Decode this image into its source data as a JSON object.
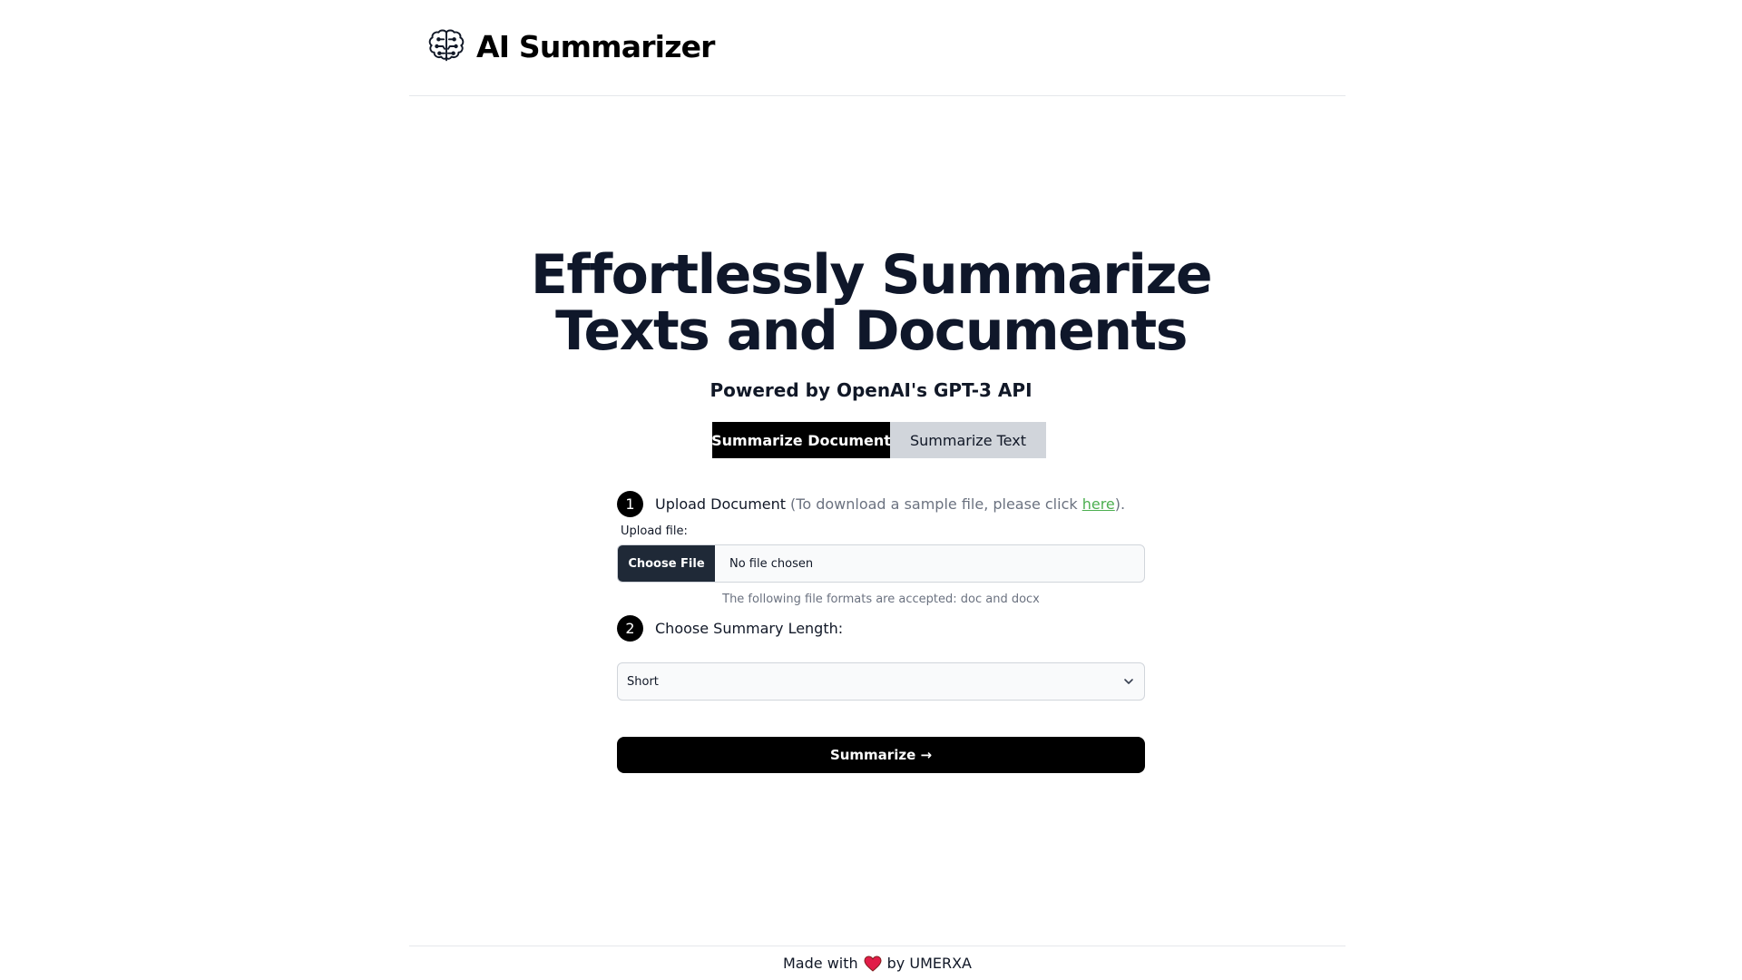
{
  "header": {
    "brand_title": "AI Summarizer",
    "logo_icon": "brain-icon"
  },
  "hero": {
    "title_line1": "Effortlessly Summarize",
    "title_line2": "Texts and Documents",
    "subtitle": "Powered by OpenAI's GPT-3 API"
  },
  "tabs": [
    {
      "label": "Summarize Document",
      "active": true
    },
    {
      "label": "Summarize Text",
      "active": false
    }
  ],
  "step1": {
    "number": "1",
    "title": "Upload Document",
    "note_prefix": "(To download a sample file, please click ",
    "link_text": "here",
    "note_suffix": ")."
  },
  "upload": {
    "label": "Upload file:",
    "button_label": "Choose File",
    "status": "No file chosen",
    "help": "The following file formats are accepted: doc and docx"
  },
  "step2": {
    "number": "2",
    "title": "Choose Summary Length:"
  },
  "summary_length": {
    "selected": "Short"
  },
  "submit": {
    "label": "Summarize →"
  },
  "footer": {
    "prefix": "Made with",
    "suffix": "by UMERXA",
    "heart_icon": "heart-icon"
  },
  "colors": {
    "primary": "#000000",
    "inactive_tab": "#d1d5db",
    "link": "#4caf50",
    "heart": "#e11d48"
  }
}
